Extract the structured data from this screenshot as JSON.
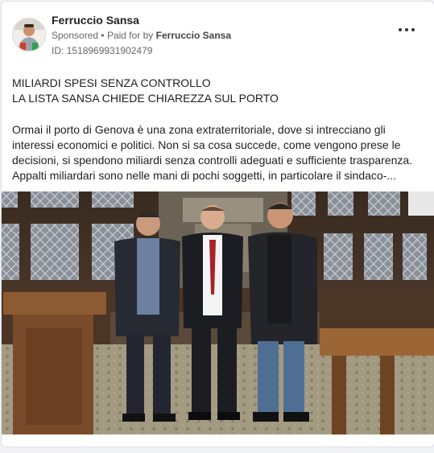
{
  "post": {
    "page_name": "Ferruccio Sansa",
    "sponsored_label": "Sponsored",
    "separator": "•",
    "paid_for_prefix": "Paid for by",
    "paid_for_by": "Ferruccio Sansa",
    "ad_id": "ID: 1518969931902479",
    "headline_line1": "MILIARDI SPESI SENZA CONTROLLO",
    "headline_line2": "LA LISTA SANSA CHIEDE CHIAREZZA SUL PORTO",
    "body_line1": "Ormai il porto di Genova è una zona extraterritoriale, dove si intrecciano gli",
    "body_line2": "interessi economici e politici. Non si sa cosa succede, come vengono prese le",
    "body_line3": "decisioni, si spendono miliardi senza controlli adeguati e sufficiente trasparenza.",
    "body_line4": "Appalti miliardari sono nelle mani di pochi soggetti, in particolare il sindaco-..."
  },
  "icons": {
    "more": "more-horizontal-icon",
    "avatar": "profile-photo"
  },
  "colors": {
    "card_background": "#ffffff",
    "page_background": "#f0f2f5",
    "secondary_text": "#65676b"
  }
}
